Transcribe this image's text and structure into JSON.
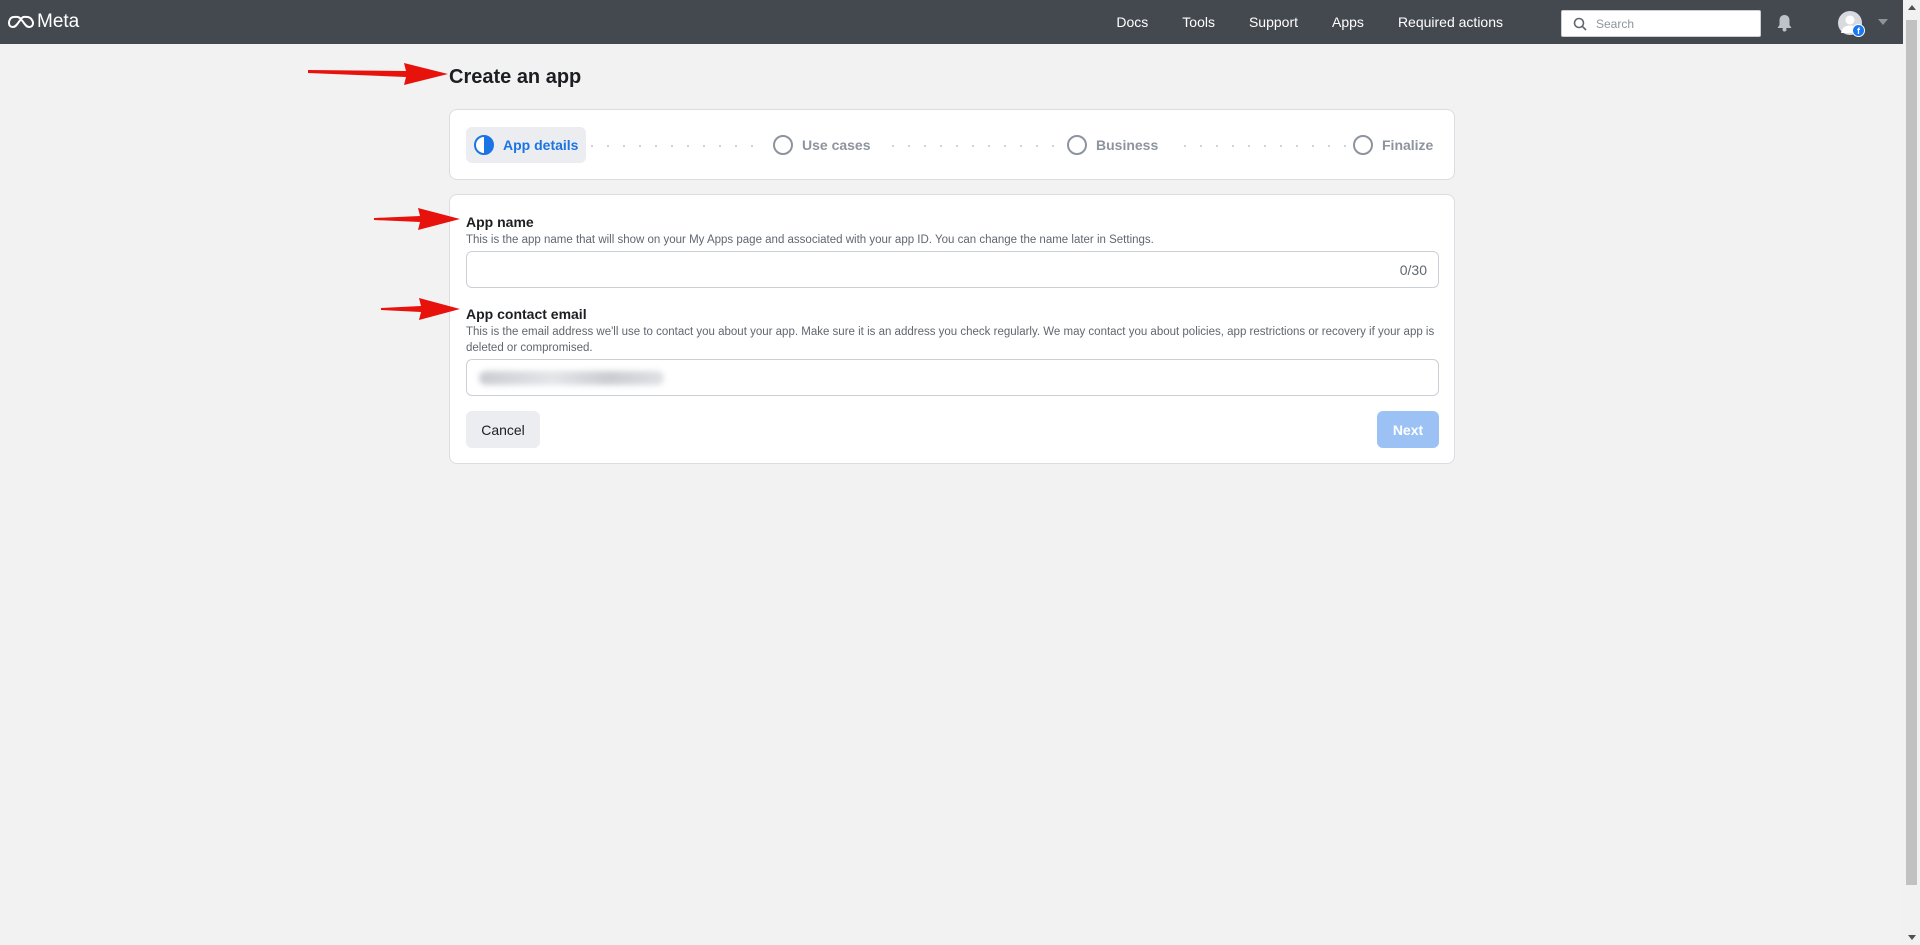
{
  "topbar": {
    "brand": "Meta",
    "nav": [
      "Docs",
      "Tools",
      "Support",
      "Apps",
      "Required actions"
    ],
    "search_placeholder": "Search"
  },
  "page": {
    "title": "Create an app"
  },
  "stepper": {
    "steps": [
      {
        "label": "App details",
        "state": "active"
      },
      {
        "label": "Use cases",
        "state": "inactive"
      },
      {
        "label": "Business",
        "state": "inactive"
      },
      {
        "label": "Finalize",
        "state": "inactive"
      }
    ]
  },
  "form": {
    "app_name": {
      "title": "App name",
      "description": "This is the app name that will show on your My Apps page and associated with your app ID. You can change the name later in Settings.",
      "value": "",
      "counter": "0/30"
    },
    "app_contact_email": {
      "title": "App contact email",
      "description": "This is the email address we'll use to contact you about your app. Make sure it is an address you check regularly. We may contact you about policies, app restrictions or recovery if your app is deleted or compromised."
    },
    "cancel_label": "Cancel",
    "next_label": "Next"
  },
  "colors": {
    "topbar": "#444950",
    "accent": "#1b74e4",
    "next_disabled": "#9cc2f5",
    "annotation_arrow": "#e8120c"
  }
}
